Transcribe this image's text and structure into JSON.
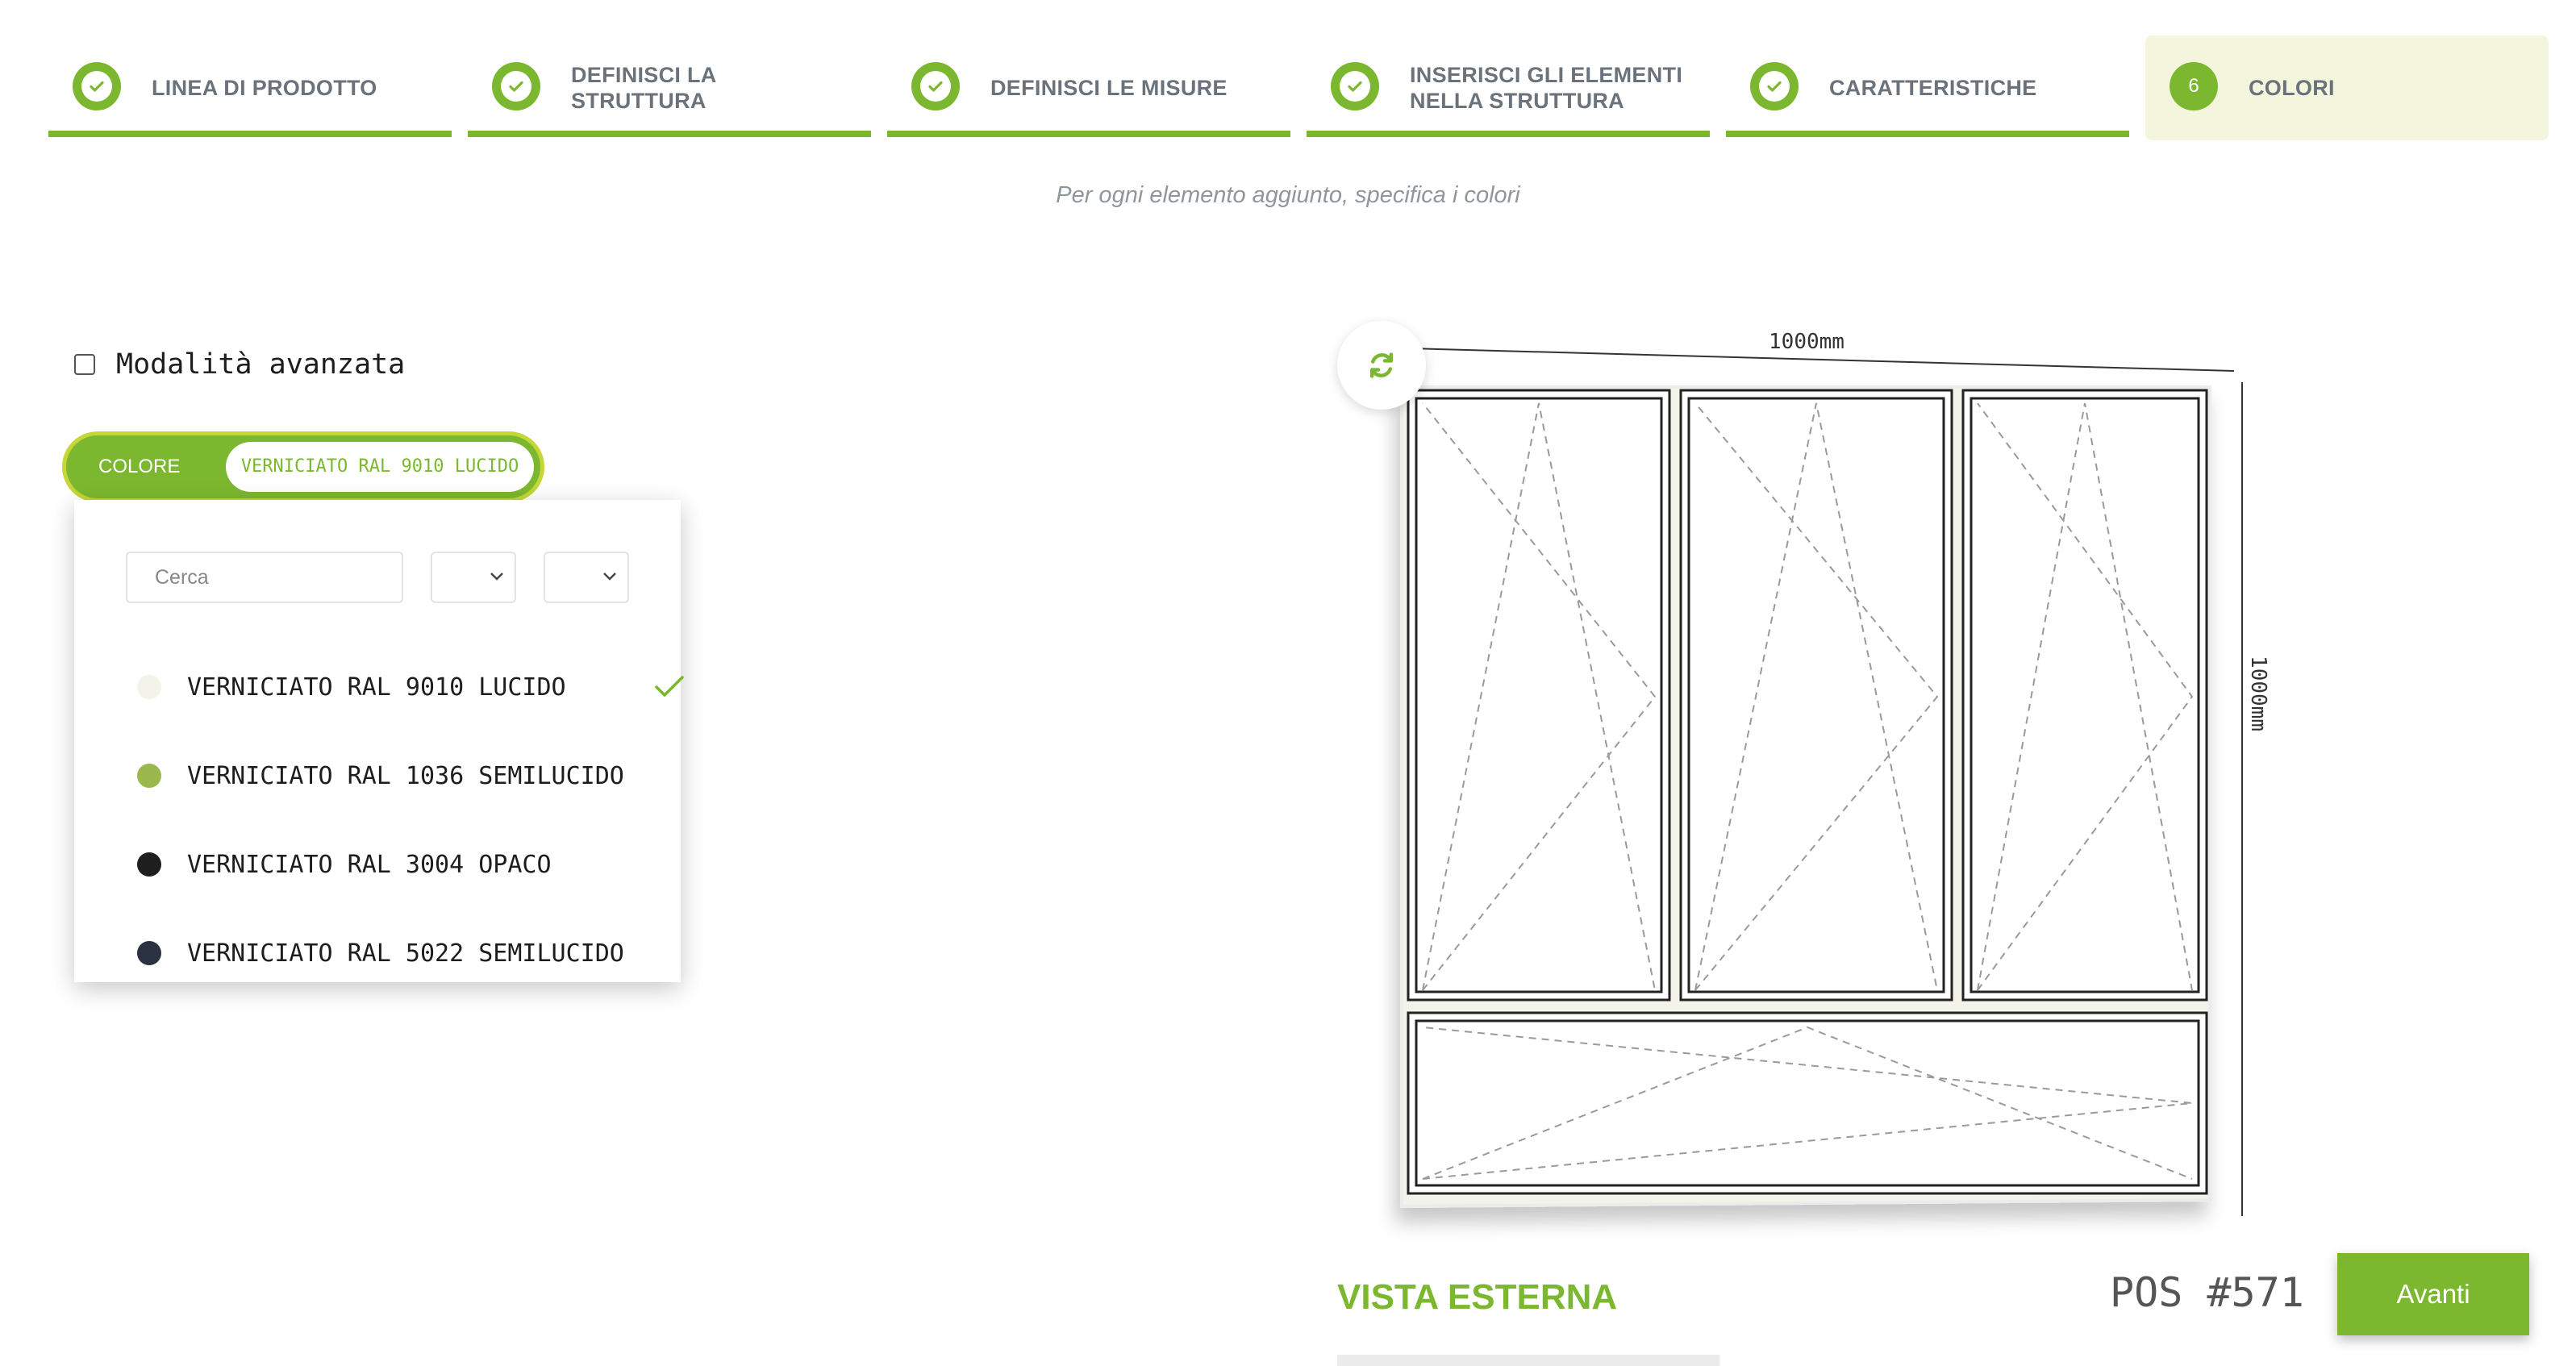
{
  "steps": [
    {
      "label": "LINEA DI PRODOTTO",
      "state": "done"
    },
    {
      "label": "DEFINISCI LA\nSTRUTTURA",
      "state": "done"
    },
    {
      "label": "DEFINISCI LE MISURE",
      "state": "done"
    },
    {
      "label": "INSERISCI GLI ELEMENTI\nNELLA STRUTTURA",
      "state": "done"
    },
    {
      "label": "CARATTERISTICHE",
      "state": "done"
    },
    {
      "label": "COLORI",
      "state": "active",
      "number": "6"
    }
  ],
  "subtitle": "Per ogni elemento aggiunto, specifica i colori",
  "advanced_mode": {
    "label": "Modalità avanzata",
    "checked": false
  },
  "color_selector": {
    "label": "COLORE",
    "value": "VERNICIATO RAL 9010 LUCIDO"
  },
  "dropdown": {
    "search_placeholder": "Cerca",
    "options": [
      {
        "name": "VERNICIATO RAL 9010 LUCIDO",
        "color": "#f3f3ea",
        "selected": true
      },
      {
        "name": "VERNICIATO RAL 1036 SEMILUCIDO",
        "color": "#9ab84e",
        "selected": false
      },
      {
        "name": "VERNICIATO RAL 3004 OPACO",
        "color": "#1e1e1e",
        "selected": false
      },
      {
        "name": "VERNICIATO RAL 5022 SEMILUCIDO",
        "color": "#2a3140",
        "selected": false
      }
    ]
  },
  "drawing": {
    "width_label": "1000mm",
    "height_label": "1000mm"
  },
  "view_label": "VISTA ESTERNA",
  "position": "POS #571",
  "next_button": "Avanti",
  "colors": {
    "accent": "#7cb82f",
    "active_step_bg": "#f3f6dc",
    "frame_color": "#f3f3ea"
  }
}
